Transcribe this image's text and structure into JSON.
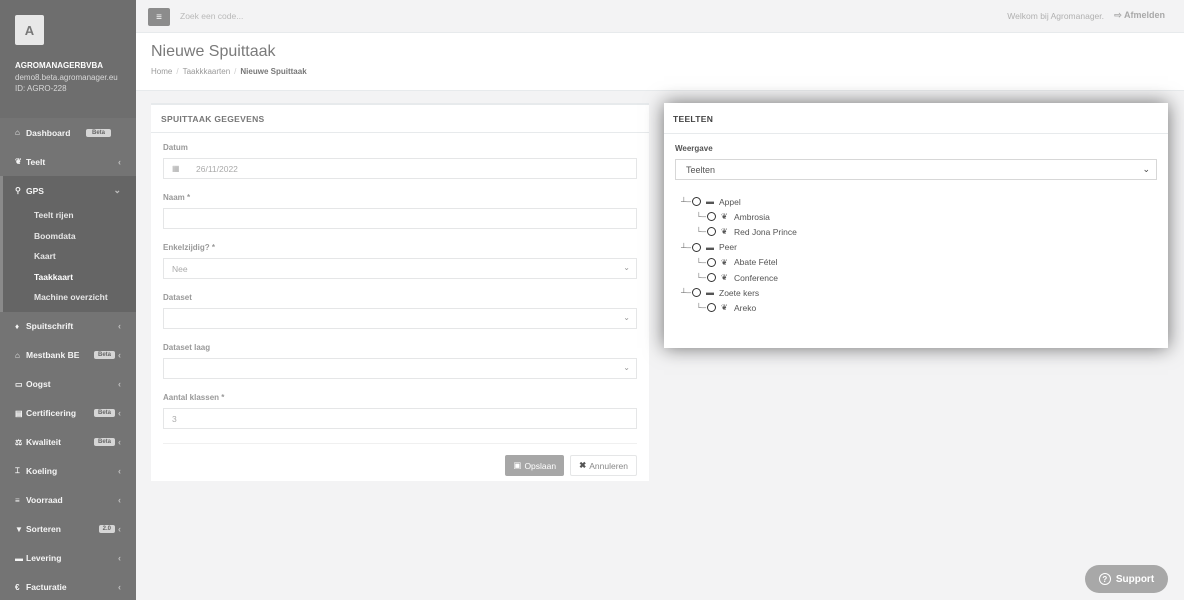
{
  "profile": {
    "avatar_letter": "A",
    "company": "AGROMANAGERBVBA",
    "email": "demo8.beta.agromanager.eu",
    "id": "ID: AGRO-228"
  },
  "sidebar": {
    "items": [
      {
        "icon": "home-icon",
        "glyph": "⌂",
        "label": "Dashboard",
        "badge": "Beta"
      },
      {
        "icon": "leaf-icon",
        "glyph": "❦",
        "label": "Teelt"
      },
      {
        "icon": "map-marker-icon",
        "glyph": "⚲",
        "label": "GPS",
        "expanded": true
      },
      {
        "icon": "flask-icon",
        "glyph": "♦",
        "label": "Spuitschrift"
      },
      {
        "icon": "bank-icon",
        "glyph": "⌂",
        "label": "Mestbank BE",
        "badge": "Beta"
      },
      {
        "icon": "basket-icon",
        "glyph": "▭",
        "label": "Oogst"
      },
      {
        "icon": "certificate-icon",
        "glyph": "▤",
        "label": "Certificering",
        "badge": "Beta"
      },
      {
        "icon": "balance-icon",
        "glyph": "⚖",
        "label": "Kwaliteit",
        "badge": "Beta"
      },
      {
        "icon": "thermometer-icon",
        "glyph": "⌶",
        "label": "Koeling"
      },
      {
        "icon": "list-icon",
        "glyph": "≡",
        "label": "Voorraad"
      },
      {
        "icon": "filter-icon",
        "glyph": "▼",
        "label": "Sorteren",
        "badge": "2.0"
      },
      {
        "icon": "truck-icon",
        "glyph": "▬",
        "label": "Levering"
      },
      {
        "icon": "euro-icon",
        "glyph": "€",
        "label": "Facturatie"
      }
    ],
    "gps_sub": [
      "Teelt rijen",
      "Boomdata",
      "Kaart",
      "Taakkaart",
      "Machine overzicht"
    ],
    "gps_current": "Taakkaart"
  },
  "topbar": {
    "search_placeholder": "Zoek een code...",
    "welcome": "Welkom bij Agromanager.",
    "logout": "Afmelden"
  },
  "header": {
    "title": "Nieuwe Spuittaak",
    "breadcrumb": [
      "Home",
      "Taakkkaarten",
      "Nieuwe Spuittaak"
    ]
  },
  "form": {
    "title": "SPUITTAAK GEGEVENS",
    "datum_label": "Datum",
    "datum_value": "26/11/2022",
    "naam_label": "Naam *",
    "naam_value": "",
    "enkelzijdig_label": "Enkelzijdig? *",
    "enkelzijdig_value": "Nee",
    "dataset_label": "Dataset",
    "dataset_value": "",
    "dataset_laag_label": "Dataset laag",
    "dataset_laag_value": "",
    "klassen_label": "Aantal klassen *",
    "klassen_value": "3",
    "save_label": "Opslaan",
    "cancel_label": "Annuleren"
  },
  "teelten": {
    "title": "TEELTEN",
    "weergave_label": "Weergave",
    "weergave_value": "Teelten",
    "tree": [
      {
        "label": "Appel",
        "children": [
          "Ambrosia",
          "Red Jona Prince"
        ]
      },
      {
        "label": "Peer",
        "children": [
          "Abate Fétel",
          "Conference"
        ]
      },
      {
        "label": "Zoete kers",
        "children": [
          "Areko"
        ]
      }
    ]
  },
  "support_label": "Support"
}
